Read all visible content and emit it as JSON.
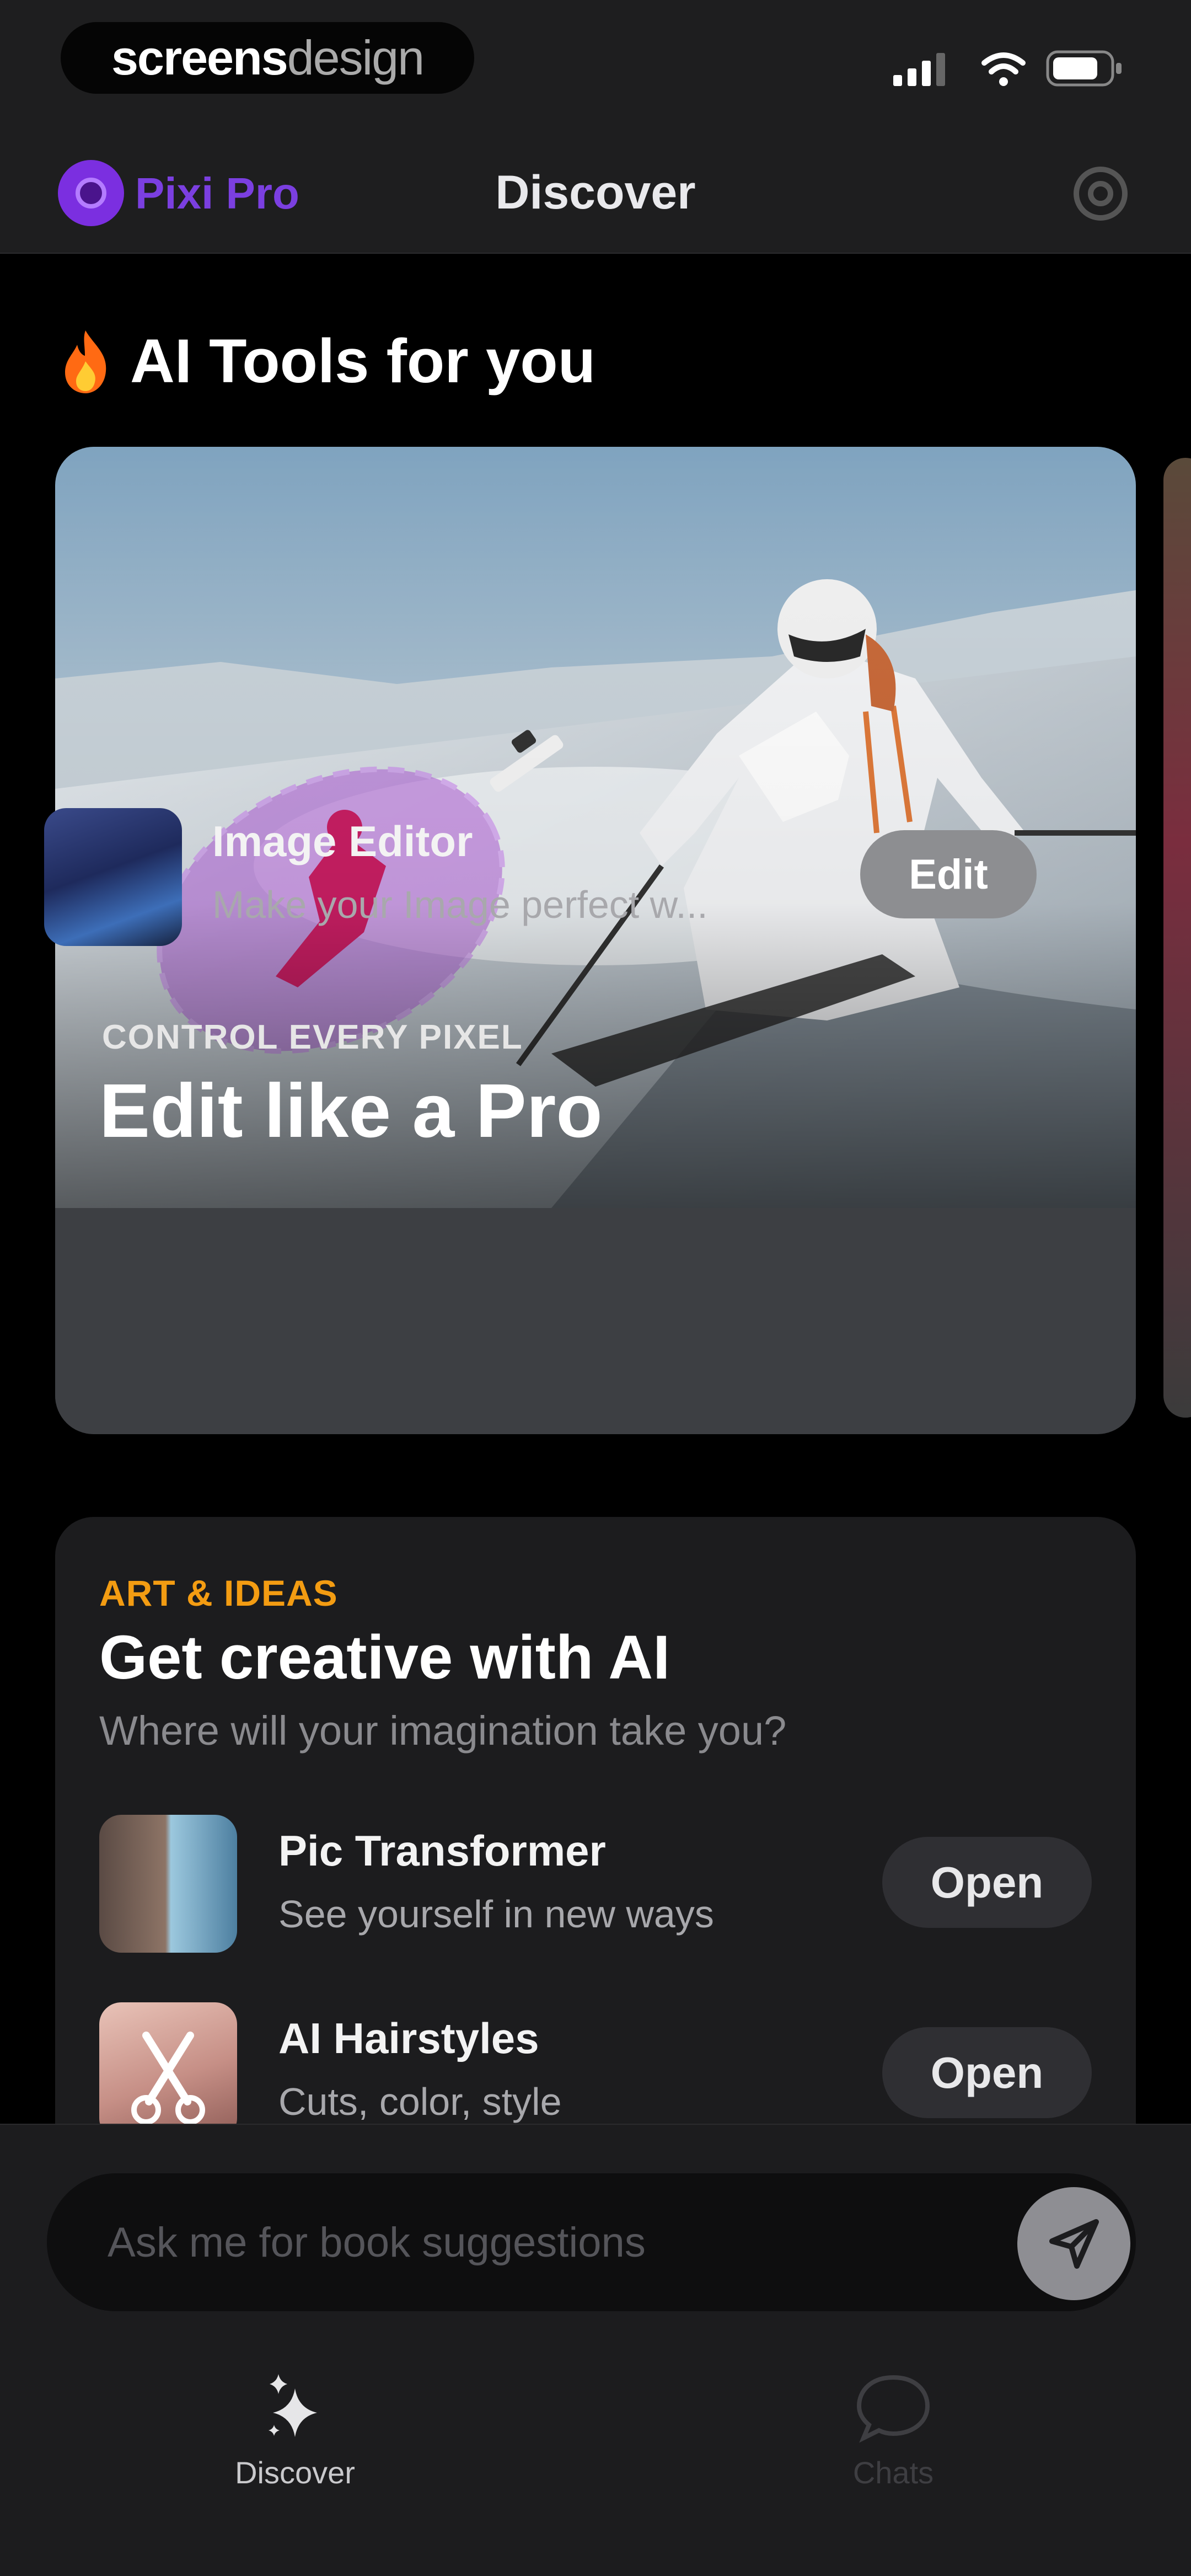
{
  "status_bar": {
    "brand_bold": "screens",
    "brand_light": "design",
    "icons": [
      "signal-icon",
      "wifi-icon",
      "battery-icon"
    ]
  },
  "nav": {
    "pro_label": "Pixi Pro",
    "title": "Discover",
    "settings_icon": "gear-icon"
  },
  "section": {
    "emoji": "flame-icon",
    "title": "AI Tools for you"
  },
  "hero": {
    "eyebrow": "CONTROL EVERY PIXEL",
    "title": "Edit like a Pro",
    "tool_name": "Image Editor",
    "tool_sub": "Make your Image perfect w...",
    "button_label": "Edit"
  },
  "creative": {
    "eyebrow": "ART & IDEAS",
    "title": "Get creative with AI",
    "subtitle": "Where will your imagination take you?",
    "tools": [
      {
        "name": "Pic Transformer",
        "sub": "See yourself in new ways",
        "button": "Open"
      },
      {
        "name": "AI Hairstyles",
        "sub": "Cuts, color, style",
        "button": "Open"
      }
    ]
  },
  "chat": {
    "placeholder": "Ask me for book suggestions"
  },
  "tabs": [
    {
      "label": "Discover",
      "icon": "sparkles-icon",
      "active": true
    },
    {
      "label": "Chats",
      "icon": "chat-bubble-icon",
      "active": false
    }
  ],
  "colors": {
    "accent_purple": "#7b3fe0",
    "eyebrow_orange": "#f39c12",
    "background": "#000000",
    "card": "#1c1c1e"
  }
}
